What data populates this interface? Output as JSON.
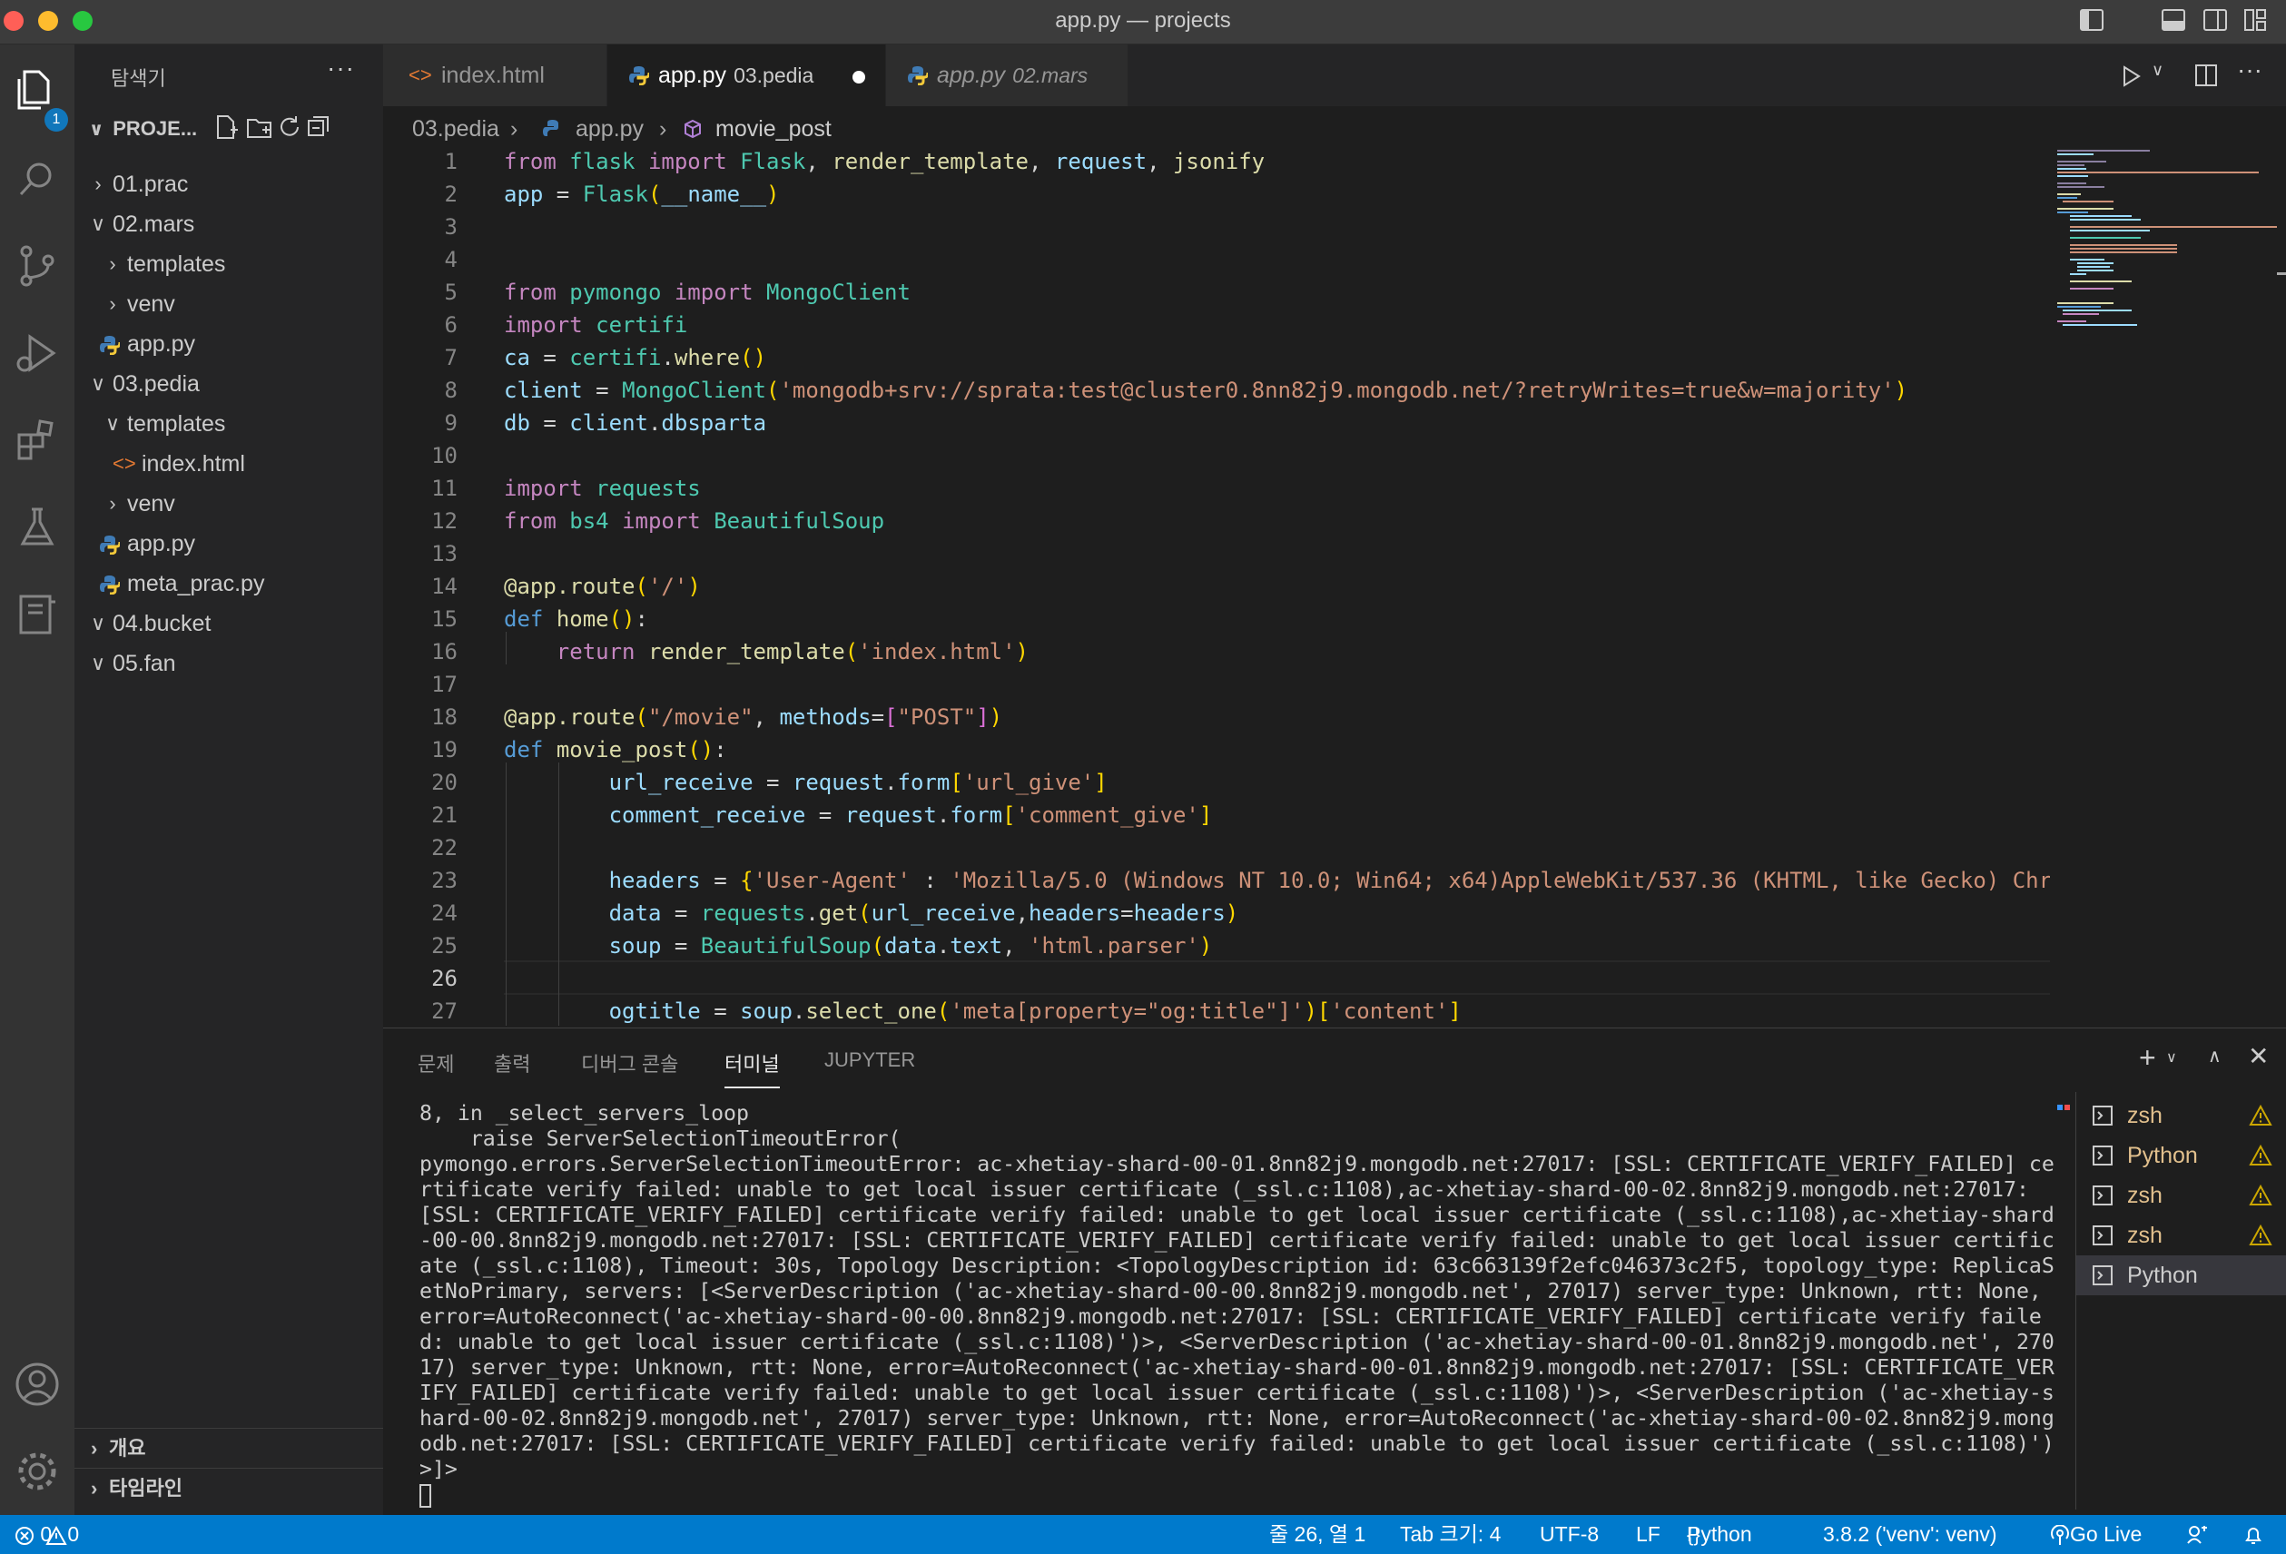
{
  "window": {
    "title": "app.py — projects"
  },
  "sidebar": {
    "title": "탐색기",
    "more": "···",
    "section_title": "PROJE...",
    "tree": [
      {
        "label": "01.prac",
        "type": "folder",
        "expanded": false,
        "depth": 0
      },
      {
        "label": "02.mars",
        "type": "folder",
        "expanded": true,
        "depth": 0
      },
      {
        "label": "templates",
        "type": "folder",
        "expanded": false,
        "depth": 1
      },
      {
        "label": "venv",
        "type": "folder",
        "expanded": false,
        "depth": 1
      },
      {
        "label": "app.py",
        "type": "python",
        "depth": 1
      },
      {
        "label": "03.pedia",
        "type": "folder",
        "expanded": true,
        "depth": 0
      },
      {
        "label": "templates",
        "type": "folder",
        "expanded": true,
        "depth": 1
      },
      {
        "label": "index.html",
        "type": "html",
        "depth": 2
      },
      {
        "label": "venv",
        "type": "folder",
        "expanded": false,
        "depth": 1
      },
      {
        "label": "app.py",
        "type": "python",
        "depth": 1
      },
      {
        "label": "meta_prac.py",
        "type": "python",
        "depth": 1
      },
      {
        "label": "04.bucket",
        "type": "folder",
        "expanded": true,
        "depth": 0
      },
      {
        "label": "05.fan",
        "type": "folder",
        "expanded": true,
        "depth": 0
      }
    ],
    "outline_label": "개요",
    "timeline_label": "타임라인"
  },
  "activity": {
    "explorer_badge": "1"
  },
  "tabs": [
    {
      "name": "index.html",
      "desc": "",
      "icon": "html-icon",
      "active": false,
      "italic": false
    },
    {
      "name": "app.py",
      "desc": "03.pedia",
      "icon": "python-icon",
      "active": true,
      "italic": false,
      "modified": true
    },
    {
      "name": "app.py",
      "desc": "02.mars",
      "icon": "python-icon",
      "active": false,
      "italic": true
    }
  ],
  "breadcrumb": {
    "folder": "03.pedia",
    "file": "app.py",
    "symbol": "movie_post"
  },
  "editor": {
    "line_numbers": [
      "1",
      "2",
      "3",
      "4",
      "5",
      "6",
      "7",
      "8",
      "9",
      "10",
      "11",
      "12",
      "13",
      "14",
      "15",
      "16",
      "17",
      "18",
      "19",
      "20",
      "21",
      "22",
      "23",
      "24",
      "25",
      "26",
      "27"
    ],
    "current_line": 26
  },
  "panel": {
    "tabs": [
      "문제",
      "출력",
      "디버그 콘솔",
      "터미널",
      "JUPYTER"
    ],
    "active_tab": "터미널",
    "terminal_output": "8, in _select_servers_loop\n    raise ServerSelectionTimeoutError(\npymongo.errors.ServerSelectionTimeoutError: ac-xhetiay-shard-00-01.8nn82j9.mongodb.net:27017: [SSL: CERTIFICATE_VERIFY_FAILED] certificate verify failed: unable to get local issuer certificate (_ssl.c:1108),ac-xhetiay-shard-00-02.8nn82j9.mongodb.net:27017: [SSL: CERTIFICATE_VERIFY_FAILED] certificate verify failed: unable to get local issuer certificate (_ssl.c:1108),ac-xhetiay-shard-00-00.8nn82j9.mongodb.net:27017: [SSL: CERTIFICATE_VERIFY_FAILED] certificate verify failed: unable to get local issuer certificate (_ssl.c:1108), Timeout: 30s, Topology Description: <TopologyDescription id: 63c663139f2efc046373c2f5, topology_type: ReplicaSetNoPrimary, servers: [<ServerDescription ('ac-xhetiay-shard-00-00.8nn82j9.mongodb.net', 27017) server_type: Unknown, rtt: None, error=AutoReconnect('ac-xhetiay-shard-00-00.8nn82j9.mongodb.net:27017: [SSL: CERTIFICATE_VERIFY_FAILED] certificate verify failed: unable to get local issuer certificate (_ssl.c:1108)')>, <ServerDescription ('ac-xhetiay-shard-00-01.8nn82j9.mongodb.net', 27017) server_type: Unknown, rtt: None, error=AutoReconnect('ac-xhetiay-shard-00-01.8nn82j9.mongodb.net:27017: [SSL: CERTIFICATE_VERIFY_FAILED] certificate verify failed: unable to get local issuer certificate (_ssl.c:1108)')>, <ServerDescription ('ac-xhetiay-shard-00-02.8nn82j9.mongodb.net', 27017) server_type: Unknown, rtt: None, error=AutoReconnect('ac-xhetiay-shard-00-02.8nn82j9.mongodb.net:27017: [SSL: CERTIFICATE_VERIFY_FAILED] certificate verify failed: unable to get local issuer certificate (_ssl.c:1108)')>]>",
    "terminals": [
      {
        "name": "zsh",
        "warning": true
      },
      {
        "name": "Python",
        "warning": true
      },
      {
        "name": "zsh",
        "warning": true
      },
      {
        "name": "zsh",
        "warning": true
      },
      {
        "name": "Python",
        "warning": false,
        "selected": true
      }
    ]
  },
  "status": {
    "errors": "0",
    "warnings": "0",
    "position": "줄 26, 열 1",
    "tab_size": "Tab 크기: 4",
    "encoding": "UTF-8",
    "eol": "LF",
    "language": "Python",
    "interpreter": "3.8.2 ('venv': venv)",
    "go_live": "Go Live"
  },
  "colors": {
    "accent": "#007acc",
    "badge": "#1177bb",
    "warning": "#cca700"
  }
}
